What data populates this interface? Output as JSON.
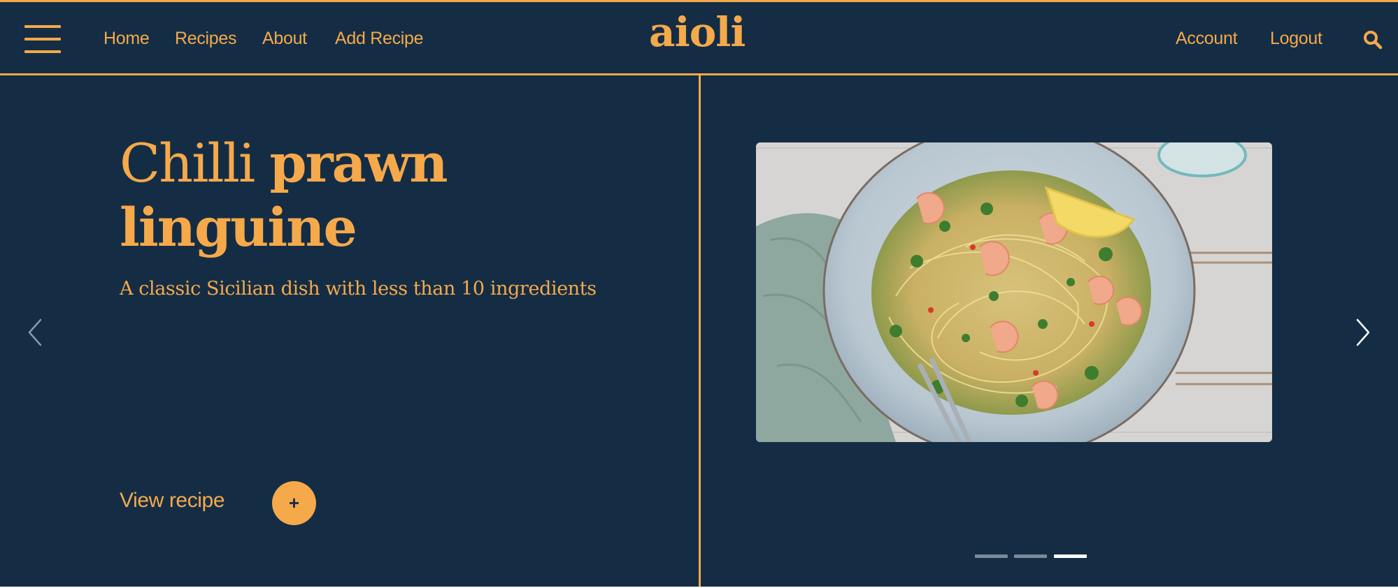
{
  "header": {
    "logo": "aioli",
    "nav": [
      {
        "label": "Home"
      },
      {
        "label": "Recipes"
      },
      {
        "label": "About"
      },
      {
        "label": "Add Recipe"
      }
    ],
    "right_nav": [
      {
        "label": "Account"
      },
      {
        "label": "Logout"
      }
    ],
    "menu_icon": "hamburger-menu-icon",
    "search_icon": "search-icon"
  },
  "hero": {
    "title_light": "Chilli",
    "title_bold": "prawn linguine",
    "subtitle": "A classic Sicilian dish with less than 10 ingredients",
    "cta_label": "View recipe",
    "cta_icon_label": "+",
    "prev_icon": "chevron-left-icon",
    "next_icon": "chevron-right-icon",
    "image_subject": "plate-of-prawn-linguine-photo"
  },
  "carousel": {
    "slide_count": 3,
    "active_index": 2
  },
  "colors": {
    "background": "#142d45",
    "accent": "#f5a94a",
    "dot_inactive": "#7a8a9a",
    "dot_active": "#ffffff",
    "prev_arrow": "#8a97a5",
    "next_arrow": "#ffffff"
  }
}
